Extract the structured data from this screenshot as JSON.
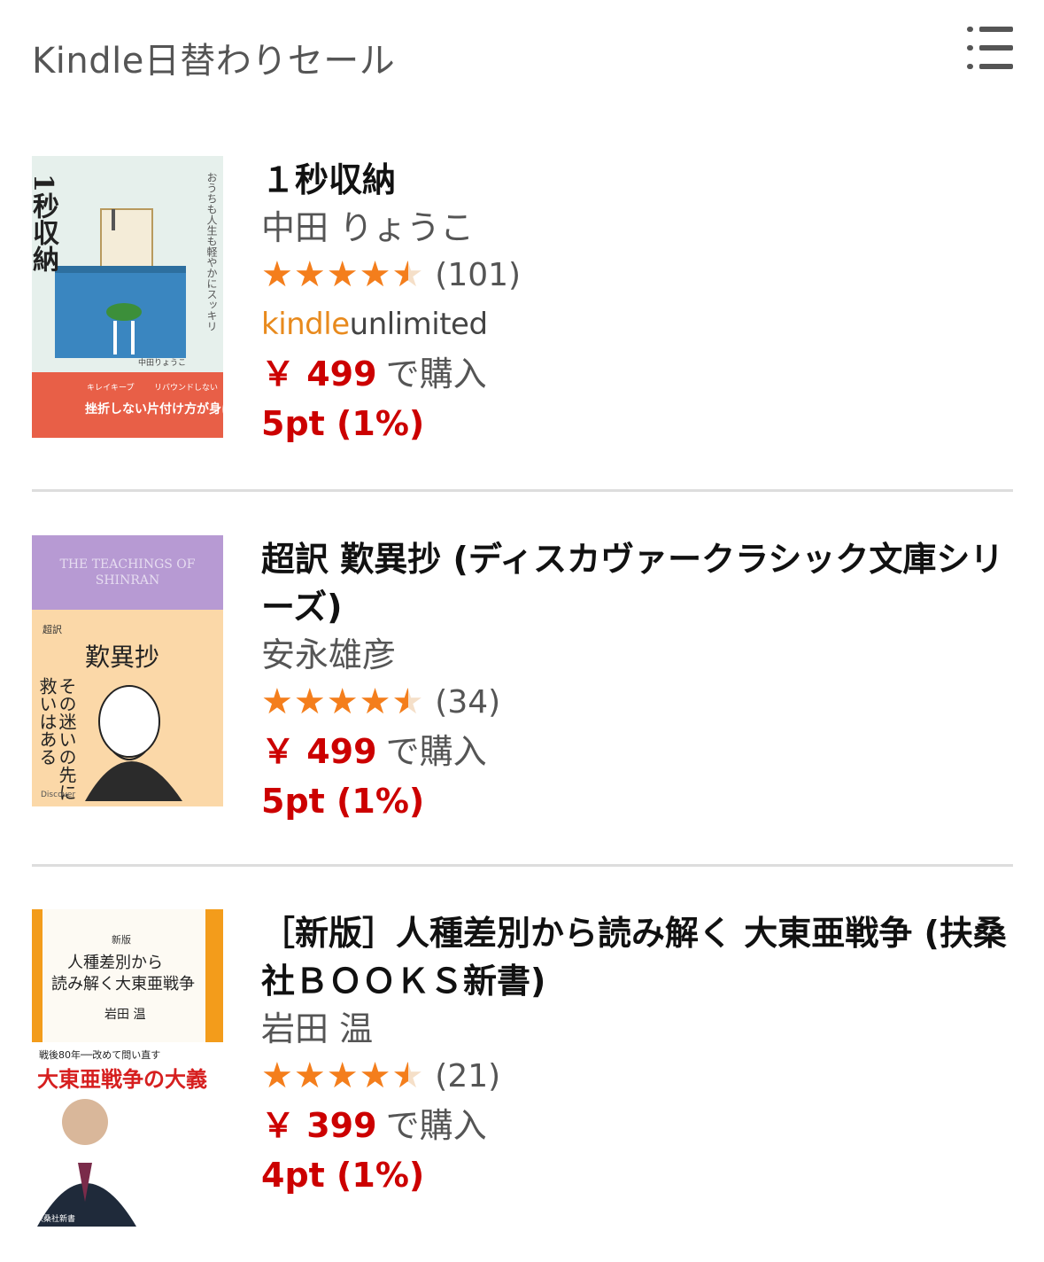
{
  "header": {
    "title": "Kindle日替わりセール",
    "menu_icon": "list-icon"
  },
  "books": [
    {
      "title": "１秒収納",
      "author": "中田 りょうこ",
      "rating": 4.5,
      "rating_count": "(101)",
      "kindle_unlimited": {
        "part1": "kindle",
        "part2": "unlimited"
      },
      "price": "￥ 499",
      "buy_label": "で購入",
      "points": "5pt (1%)",
      "cover": {
        "title": "1秒収納",
        "subtitle": "おうちも人生も軽やかにスッキリ",
        "author": "中田りょうこ",
        "band_text": "挫折しない片付け方が身につく",
        "band_label_1": "キレイキープ",
        "band_label_2": "リバウンドしない"
      }
    },
    {
      "title": "超訳 歎異抄 (ディスカヴァークラシック文庫シリーズ)",
      "author": "安永雄彦",
      "rating": 4.5,
      "rating_count": "(34)",
      "price": "￥ 499",
      "buy_label": "で購入",
      "points": "5pt (1%)",
      "cover": {
        "english": "THE TEACHINGS OF SHINRAN",
        "small_label": "超訳",
        "title": "歎異抄",
        "phrase": "その迷いの先に救いはある",
        "publisher": "Discover"
      }
    },
    {
      "title": "［新版］人種差別から読み解く 大東亜戦争 (扶桑社ＢＯＯＫＳ新書)",
      "author": "岩田 温",
      "rating": 4.5,
      "rating_count": "(21)",
      "price": "￥ 399",
      "buy_label": "で購入",
      "points": "4pt (1%)",
      "cover": {
        "edition": "新版",
        "title_line1": "人種差別から",
        "title_line2": "読み解く大東亜戦争",
        "author": "岩田 温",
        "tagline": "戦後80年──改めて問い直す",
        "headline": "大東亜戦争の大義",
        "series": "扶桑社新書"
      }
    }
  ],
  "colors": {
    "star": "#f47e1c",
    "price": "#cc0000",
    "ku_orange": "#e88a1d",
    "muted": "#555555"
  }
}
